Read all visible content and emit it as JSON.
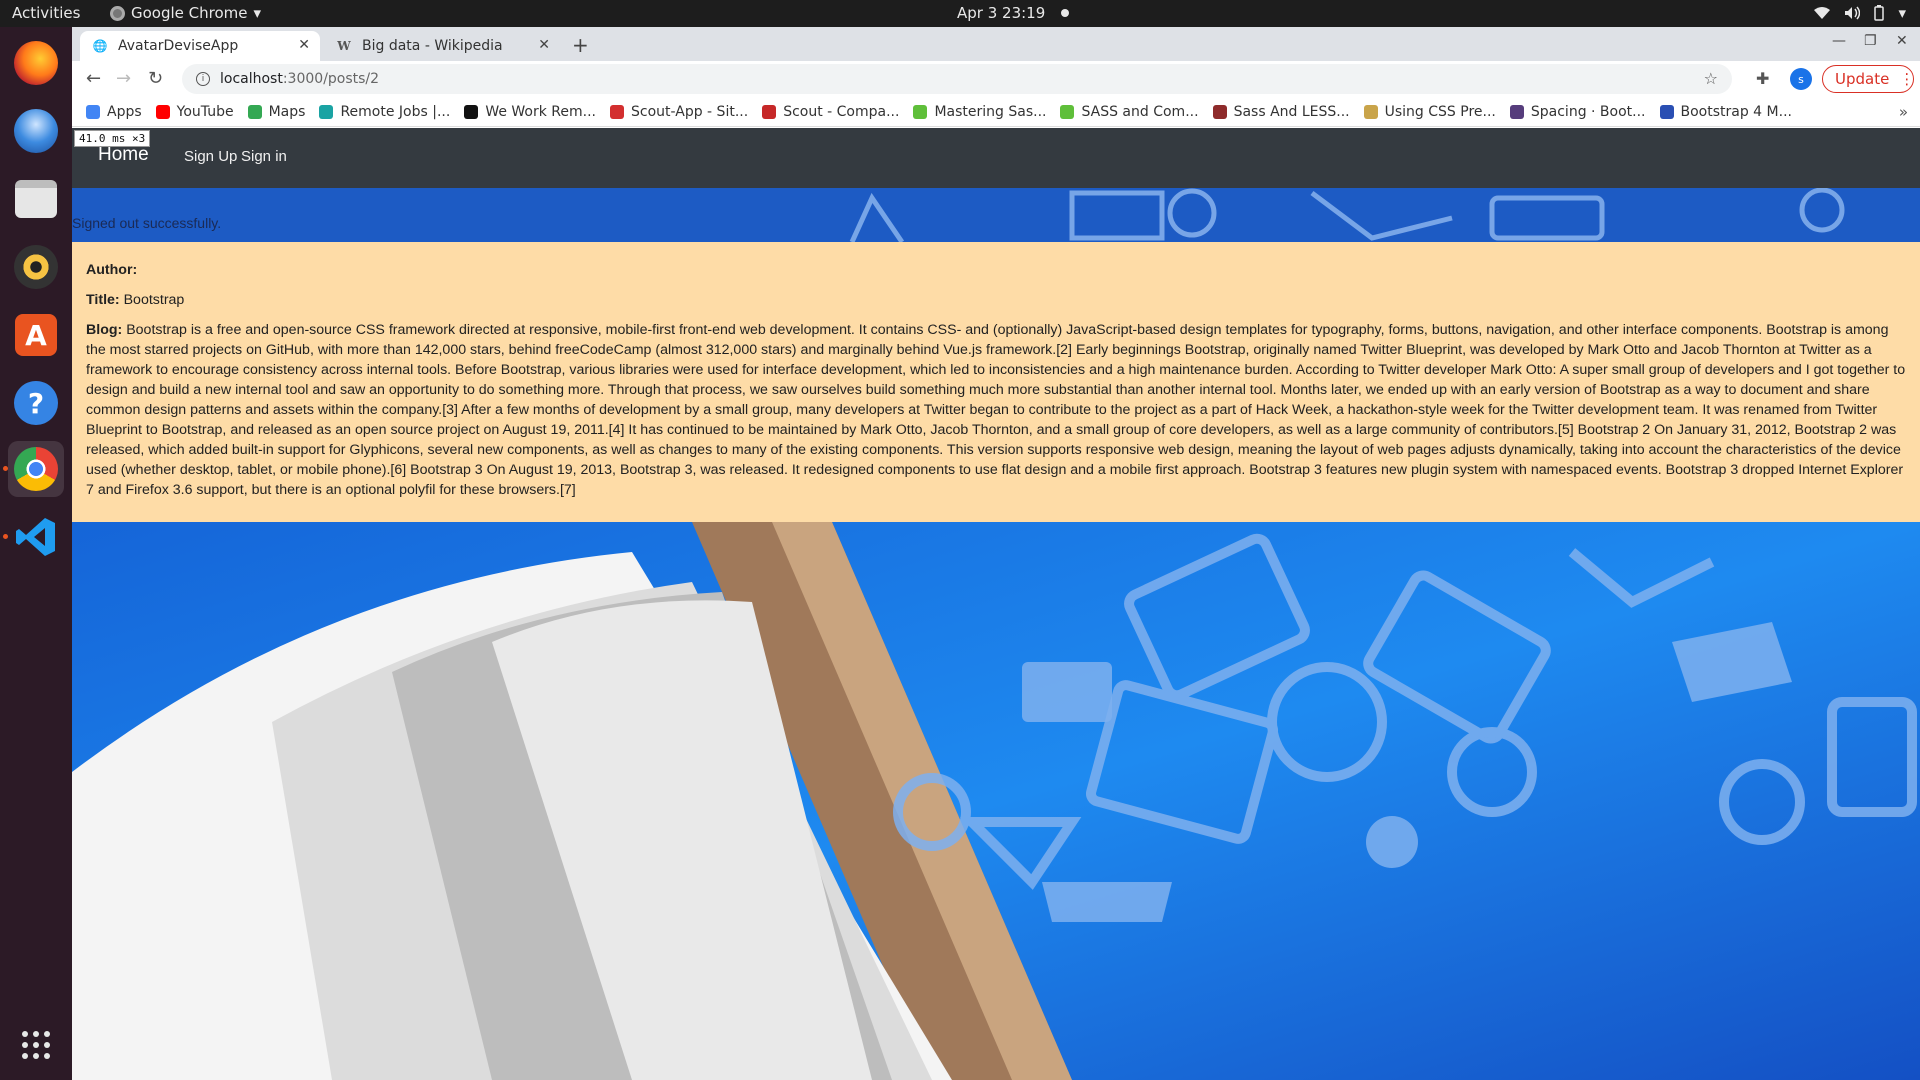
{
  "topbar": {
    "activities": "Activities",
    "app_name": "Google Chrome",
    "clock": "Apr 3  23:19"
  },
  "dock": {
    "items": [
      "firefox-icon",
      "thunderbird-icon",
      "files-icon",
      "rhythmbox-icon",
      "software-icon",
      "help-icon",
      "chrome-icon",
      "vscode-icon",
      "app-grid-icon"
    ]
  },
  "tabs": [
    {
      "title": "AvatarDeviseApp",
      "active": true
    },
    {
      "title": "Big data - Wikipedia",
      "active": false
    }
  ],
  "toolbar": {
    "url_host": "localhost",
    "url_path": ":3000/posts/2",
    "profile_initial": "s",
    "update_label": "Update"
  },
  "bookmarks": [
    {
      "label": "Apps",
      "color": "#4285f4"
    },
    {
      "label": "YouTube",
      "color": "#ff0000"
    },
    {
      "label": "Maps",
      "color": "#34a853"
    },
    {
      "label": "Remote Jobs |...",
      "color": "#1aa3a3"
    },
    {
      "label": "We Work Rem...",
      "color": "#111111"
    },
    {
      "label": "Scout-App - Sit...",
      "color": "#d32f2f"
    },
    {
      "label": "Scout - Compa...",
      "color": "#c62828"
    },
    {
      "label": "Mastering Sas...",
      "color": "#5fbf3a"
    },
    {
      "label": "SASS and Com...",
      "color": "#5fbf3a"
    },
    {
      "label": "Sass And LESS...",
      "color": "#8e2b2b"
    },
    {
      "label": "Using CSS Pre...",
      "color": "#c9a44a"
    },
    {
      "label": "Spacing · Boot...",
      "color": "#563d7c"
    },
    {
      "label": "Bootstrap 4 M...",
      "color": "#2a4fb3"
    }
  ],
  "perf_overlay": "41.0 ms ×3",
  "navbar": {
    "brand": "Home",
    "links": [
      "Sign Up",
      "Sign in"
    ]
  },
  "notice": "Signed out successfully.",
  "post": {
    "author_label": "Author:",
    "author_value": "",
    "title_label": "Title:",
    "title_value": "Bootstrap",
    "blog_label": "Blog:",
    "blog_value": "Bootstrap is a free and open-source CSS framework directed at responsive, mobile-first front-end web development. It contains CSS- and (optionally) JavaScript-based design templates for typography, forms, buttons, navigation, and other interface components. Bootstrap is among the most starred projects on GitHub, with more than 142,000 stars, behind freeCodeCamp (almost 312,000 stars) and marginally behind Vue.js framework.[2] Early beginnings Bootstrap, originally named Twitter Blueprint, was developed by Mark Otto and Jacob Thornton at Twitter as a framework to encourage consistency across internal tools. Before Bootstrap, various libraries were used for interface development, which led to inconsistencies and a high maintenance burden. According to Twitter developer Mark Otto: A super small group of developers and I got together to design and build a new internal tool and saw an opportunity to do something more. Through that process, we saw ourselves build something much more substantial than another internal tool. Months later, we ended up with an early version of Bootstrap as a way to document and share common design patterns and assets within the company.[3] After a few months of development by a small group, many developers at Twitter began to contribute to the project as a part of Hack Week, a hackathon-style week for the Twitter development team. It was renamed from Twitter Blueprint to Bootstrap, and released as an open source project on August 19, 2011.[4] It has continued to be maintained by Mark Otto, Jacob Thornton, and a small group of core developers, as well as a large community of contributors.[5] Bootstrap 2 On January 31, 2012, Bootstrap 2 was released, which added built-in support for Glyphicons, several new components, as well as changes to many of the existing components. This version supports responsive web design, meaning the layout of web pages adjusts dynamically, taking into account the characteristics of the device used (whether desktop, tablet, or mobile phone).[6] Bootstrap 3 On August 19, 2013, Bootstrap 3, was released. It redesigned components to use flat design and a mobile first approach. Bootstrap 3 features new plugin system with namespaced events. Bootstrap 3 dropped Internet Explorer 7 and Firefox 3.6 support, but there is an optional polyfil for these browsers.[7]"
  },
  "colors": {
    "navbar_bg": "#343a40",
    "card_bg": "#fedca7",
    "page_bg": "#1f6fd6",
    "update_red": "#d93025"
  }
}
